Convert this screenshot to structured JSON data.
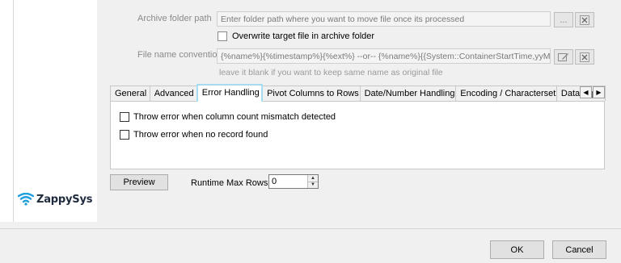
{
  "archive": {
    "label": "Archive folder path",
    "placeholder": "Enter folder path where you want to move file once its processed",
    "browse_label": "...",
    "overwrite_label": "Overwrite target file in archive folder"
  },
  "filename": {
    "label": "File name convention",
    "value": "{%name%}{%timestamp%}{%ext%} --or-- {%name%}{{System::ContainerStartTime,yyMMdd",
    "hint": "leave it blank if you want to keep same name as original file"
  },
  "tabs": [
    {
      "label": "General"
    },
    {
      "label": "Advanced"
    },
    {
      "label": "Error Handling"
    },
    {
      "label": "Pivot Columns to Rows"
    },
    {
      "label": "Date/Number Handling"
    },
    {
      "label": "Encoding / Characterset"
    },
    {
      "label": "Data Type H"
    }
  ],
  "active_tab": "Error Handling",
  "error_handling": {
    "option1": "Throw error when column count mismatch detected",
    "option2": "Throw error when no record found"
  },
  "preview": {
    "button_label": "Preview",
    "max_rows_label": "Runtime Max Rows:",
    "max_rows_value": "0"
  },
  "footer": {
    "ok_label": "OK",
    "cancel_label": "Cancel"
  },
  "brand": {
    "name": "ZappySys",
    "colors": {
      "icon": "#1c9fdc",
      "text": "#1f2b3d",
      "active_tab_border": "#a6dcf2"
    }
  }
}
